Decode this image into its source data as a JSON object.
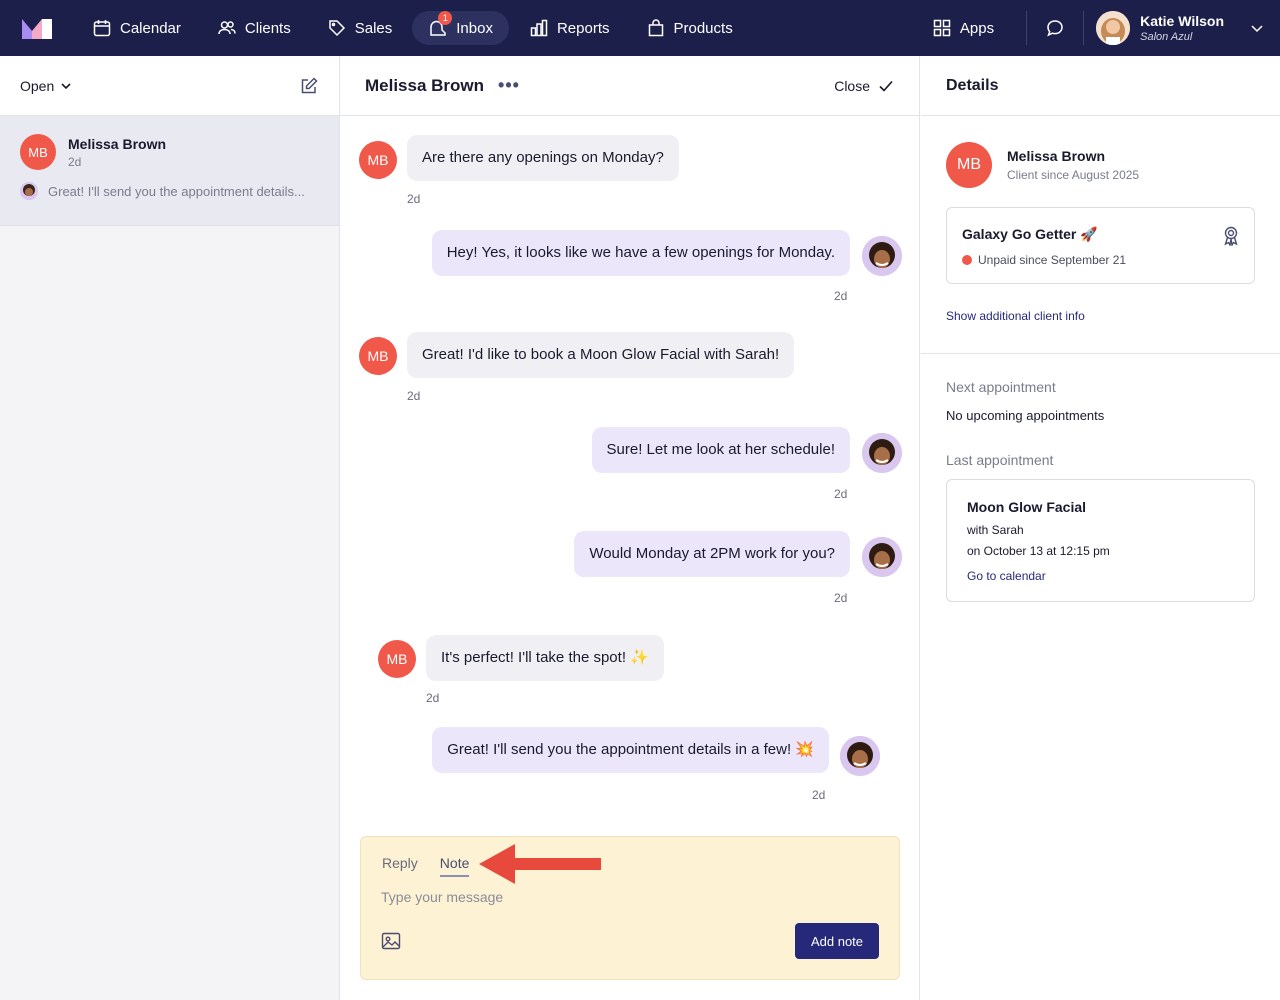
{
  "nav": {
    "items": [
      {
        "label": "Calendar",
        "icon": "calendar-icon"
      },
      {
        "label": "Clients",
        "icon": "users-icon"
      },
      {
        "label": "Sales",
        "icon": "tag-icon"
      },
      {
        "label": "Inbox",
        "icon": "inbox-icon",
        "active": true,
        "badge": "1"
      },
      {
        "label": "Reports",
        "icon": "bar-chart-icon"
      },
      {
        "label": "Products",
        "icon": "bag-icon"
      }
    ],
    "apps_label": "Apps",
    "user": {
      "name": "Katie Wilson",
      "subtitle": "Salon Azul"
    }
  },
  "sidebar": {
    "filter_label": "Open",
    "conversation": {
      "initials": "MB",
      "name": "Melissa Brown",
      "time": "2d",
      "preview": "Great! I'll send you the appointment details..."
    }
  },
  "chat": {
    "title": "Melissa Brown",
    "close_label": "Close",
    "messages": [
      {
        "dir": "in",
        "text": "Are there any openings on Monday?",
        "time": "2d",
        "initials": "MB"
      },
      {
        "dir": "out",
        "text": "Hey! Yes, it looks like we have a few openings for Monday.",
        "time": "2d"
      },
      {
        "dir": "in",
        "text": "Great! I'd like to book a Moon Glow Facial with Sarah!",
        "time": "2d",
        "initials": "MB"
      },
      {
        "dir": "out",
        "text": "Sure! Let me look at her schedule!",
        "time": "2d"
      },
      {
        "dir": "out",
        "text": "Would Monday at 2PM work for you?",
        "time": "2d"
      },
      {
        "dir": "in",
        "text": "It's perfect! I'll take the spot! ✨",
        "time": "2d",
        "initials": "MB"
      },
      {
        "dir": "out",
        "text": "Great! I'll send you the appointment details in a few! 💥",
        "time": "2d"
      }
    ],
    "composer": {
      "tab_reply": "Reply",
      "tab_note": "Note",
      "placeholder": "Type your message",
      "add_note_label": "Add note"
    }
  },
  "details": {
    "title": "Details",
    "client": {
      "initials": "MB",
      "name": "Melissa Brown",
      "since": "Client since August 2025"
    },
    "membership": {
      "name": "Galaxy Go Getter 🚀",
      "status": "Unpaid since September 21",
      "status_color": "#f0584a"
    },
    "show_more": "Show additional client info",
    "next_label": "Next appointment",
    "next_value": "No upcoming appointments",
    "last_label": "Last appointment",
    "last": {
      "service": "Moon Glow Facial",
      "with": "with Sarah",
      "when": "on October 13 at 12:15 pm",
      "link": "Go to calendar"
    }
  },
  "colors": {
    "nav_bg": "#1c1f4a",
    "accent": "#26297a",
    "avatar_red": "#f0584a",
    "note_bg": "#fdf2d3",
    "arrow": "#e8493d"
  }
}
